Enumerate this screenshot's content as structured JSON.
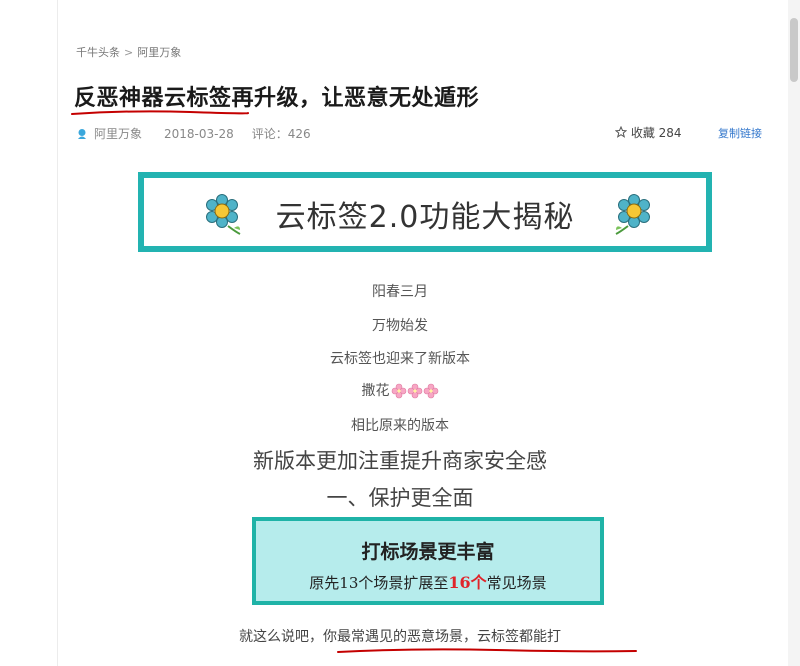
{
  "breadcrumb": {
    "section": "千牛头条",
    "separator": ">",
    "current": "阿里万象"
  },
  "article": {
    "title": "反恶神器云标签再升级，让恶意无处遁形",
    "author": "阿里万象",
    "date": "2018-03-28",
    "comments": "评论：426",
    "collect_label": "收藏 284",
    "copy_link_label": "复制链接"
  },
  "banner": {
    "text": "云标签2.0功能大揭秘"
  },
  "body_lines": {
    "l1": "阳春三月",
    "l2": "万物始发",
    "l3": "云标签也迎来了新版本",
    "l4": "撒花",
    "l5": "相比原来的版本",
    "l6": "新版本更加注重提升商家安全感",
    "l7": "一、保护更全面"
  },
  "feature_box": {
    "title": "打标场景更丰富",
    "sub_prefix": "原先13个场景扩展至",
    "sub_highlight": "16个",
    "sub_suffix": "常见场景"
  },
  "closing": {
    "prefix": "就这么说吧，",
    "emphasis": "你最常遇见的恶意场景，云标签都能打"
  },
  "colors": {
    "accent_teal": "#23b3b1",
    "box_fill": "#b6ecec",
    "highlight_red": "#e0242a",
    "link_blue": "#3377cc",
    "underline_red": "#c40000"
  },
  "icons": [
    "author-avatar-icon",
    "star-icon",
    "flower-icon",
    "cherry-blossom-icon"
  ]
}
